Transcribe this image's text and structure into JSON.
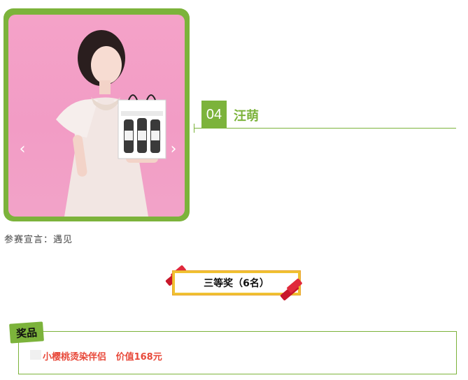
{
  "contestant": {
    "number": "04",
    "name": "汪萌",
    "declaration": "参赛宣言：遇见"
  },
  "carousel": {
    "prev_icon": "chevron-left-icon",
    "next_icon": "chevron-right-icon",
    "prev_glyph": "‹",
    "next_glyph": "›"
  },
  "award": {
    "level": "三等奖（6名）"
  },
  "prize": {
    "tag": "奖品",
    "description": "小樱桃烫染伴侣   价值168元"
  },
  "colors": {
    "accent_green": "#7cb33b",
    "prize_red": "#e8493a",
    "banner_gold": "#f0c232",
    "ribbon_red": "#c8182b",
    "photo_pink": "#f4a2c8"
  }
}
